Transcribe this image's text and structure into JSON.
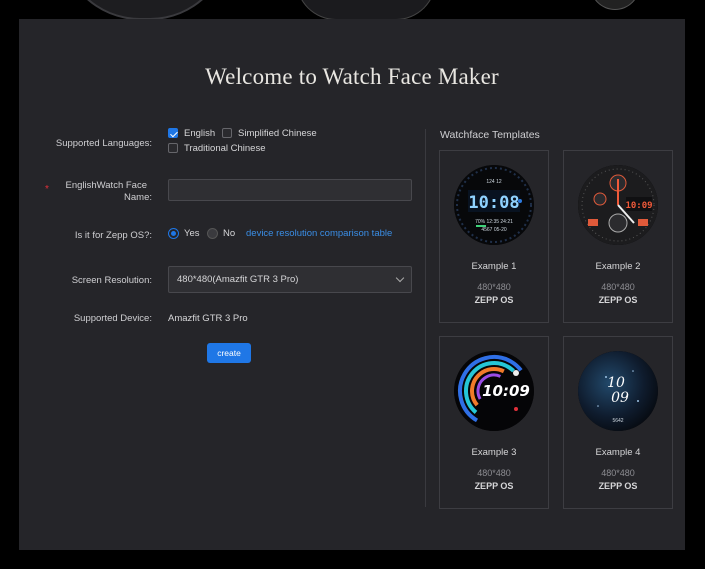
{
  "title": "Welcome to Watch Face Maker",
  "form": {
    "languages_label": "Supported Languages:",
    "languages": [
      {
        "label": "English",
        "checked": true
      },
      {
        "label": "Simplified Chinese",
        "checked": false
      },
      {
        "label": "Traditional Chinese",
        "checked": false
      }
    ],
    "name_label_line1": "EnglishWatch Face",
    "name_label_line2": "Name:",
    "required_mark": "*",
    "name_value": "",
    "zepp_label": "Is it for Zepp OS?:",
    "zepp_yes": "Yes",
    "zepp_no": "No",
    "zepp_selected": "Yes",
    "comparison_link": "device resolution comparison table",
    "resolution_label": "Screen Resolution:",
    "resolution_value": "480*480(Amazfit GTR 3 Pro)",
    "device_label": "Supported Device:",
    "device_value": "Amazfit GTR 3 Pro",
    "create_label": "create"
  },
  "templates": {
    "heading": "Watchface Templates",
    "items": [
      {
        "name": "Example 1",
        "resolution": "480*480",
        "os": "ZEPP OS",
        "time": "10:08"
      },
      {
        "name": "Example 2",
        "resolution": "480*480",
        "os": "ZEPP OS",
        "time": "10:09"
      },
      {
        "name": "Example 3",
        "resolution": "480*480",
        "os": "ZEPP OS",
        "time": "10:09"
      },
      {
        "name": "Example 4",
        "resolution": "480*480",
        "os": "ZEPP OS",
        "time": "10 09"
      }
    ]
  },
  "colors": {
    "accent": "#1f77e6",
    "panel": "#252529",
    "link": "#3a8ee6",
    "required": "#e0303a"
  }
}
